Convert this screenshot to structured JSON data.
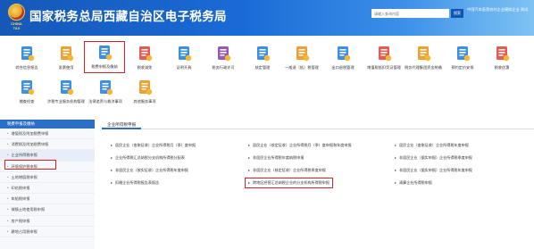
{
  "header": {
    "title": "国家税务总局西藏自治区电子税务局",
    "logo_text": "CHINA TAX",
    "search_placeholder": "请输入查询内容",
    "search_button": "搜索",
    "user_info": "中国汽车直营农村企业模拟企业 测试"
  },
  "tiles": [
    {
      "label": "综合信息报告",
      "icon": "document-icon",
      "color": "#3b8fe8"
    },
    {
      "label": "发票使用",
      "icon": "invoice-icon",
      "color": "#f0a030"
    },
    {
      "label": "税费申报及缴纳",
      "icon": "tax-declare-icon",
      "color": "#3b8fe8"
    },
    {
      "label": "税收减免",
      "icon": "tax-relief-icon",
      "color": "#e85a4f"
    },
    {
      "label": "证明开具",
      "icon": "certificate-icon",
      "color": "#3b8fe8"
    },
    {
      "label": "税务行政许可",
      "icon": "license-icon",
      "color": "#9b59b6"
    },
    {
      "label": "核定管理",
      "icon": "approval-icon",
      "color": "#3b8fe8"
    },
    {
      "label": "一般退（抵）税管理",
      "icon": "refund-icon",
      "color": "#f0a030"
    },
    {
      "label": "出口退税管理",
      "icon": "export-icon",
      "color": "#3b8fe8"
    },
    {
      "label": "增值税抵扣凭证管理",
      "icon": "voucher-icon",
      "color": "#e85a4f"
    },
    {
      "label": "税务代理集团资金统缴",
      "icon": "fund-icon",
      "color": "#f0a030"
    },
    {
      "label": "预约定价安排",
      "icon": "pricing-icon",
      "color": "#3b8fe8"
    },
    {
      "label": "税收优惠",
      "icon": "preference-icon",
      "color": "#e85a4f"
    },
    {
      "label": "稽查检查",
      "icon": "inspection-icon",
      "color": "#3b8fe8"
    },
    {
      "label": "涉税专业服务机构管理",
      "icon": "agency-icon",
      "color": "#3b8fe8"
    },
    {
      "label": "法律追责与救济事项",
      "icon": "legal-icon",
      "color": "#3b8fe8"
    },
    {
      "label": "其他服务事项",
      "icon": "service-icon",
      "color": "#f0a030"
    }
  ],
  "sidebar": {
    "header": "税费申报及缴纳",
    "items": [
      "增值税及附加税费申报",
      "消费税及附加税费申报",
      "企业所得税申报",
      "环境保护税申报",
      "土地增值税申报",
      "印花税申报",
      "车船税申报",
      "城镇土地使用税申报",
      "房产税申报",
      "耕地占用税申报"
    ]
  },
  "main": {
    "tab": "企业所得税申报",
    "links": [
      "居民企业（查账征收）企业所得税月（季）度申报",
      "居民企业（核定征收）企业所得税月（季）度申报和年度申报",
      "居民企业（查账征收）企业所得税年度申报",
      "企业所得税汇总纳税分支机构所得税分配表",
      "非居民企业所得税年度纳税申报",
      "非居民企业（据实申报）企业所得税季度申报",
      "非居民企业（按实征收）企业所得税年度申报",
      "非居民企业（核定征收）企业所得税季度申报",
      "非居民企业（据实申报）企业所得税年度申报",
      "扣缴企业所得税报告表报告",
      "跨地区经营汇总纳税企业的分支机构所得税申报",
      "清算企业所得税申报"
    ]
  }
}
